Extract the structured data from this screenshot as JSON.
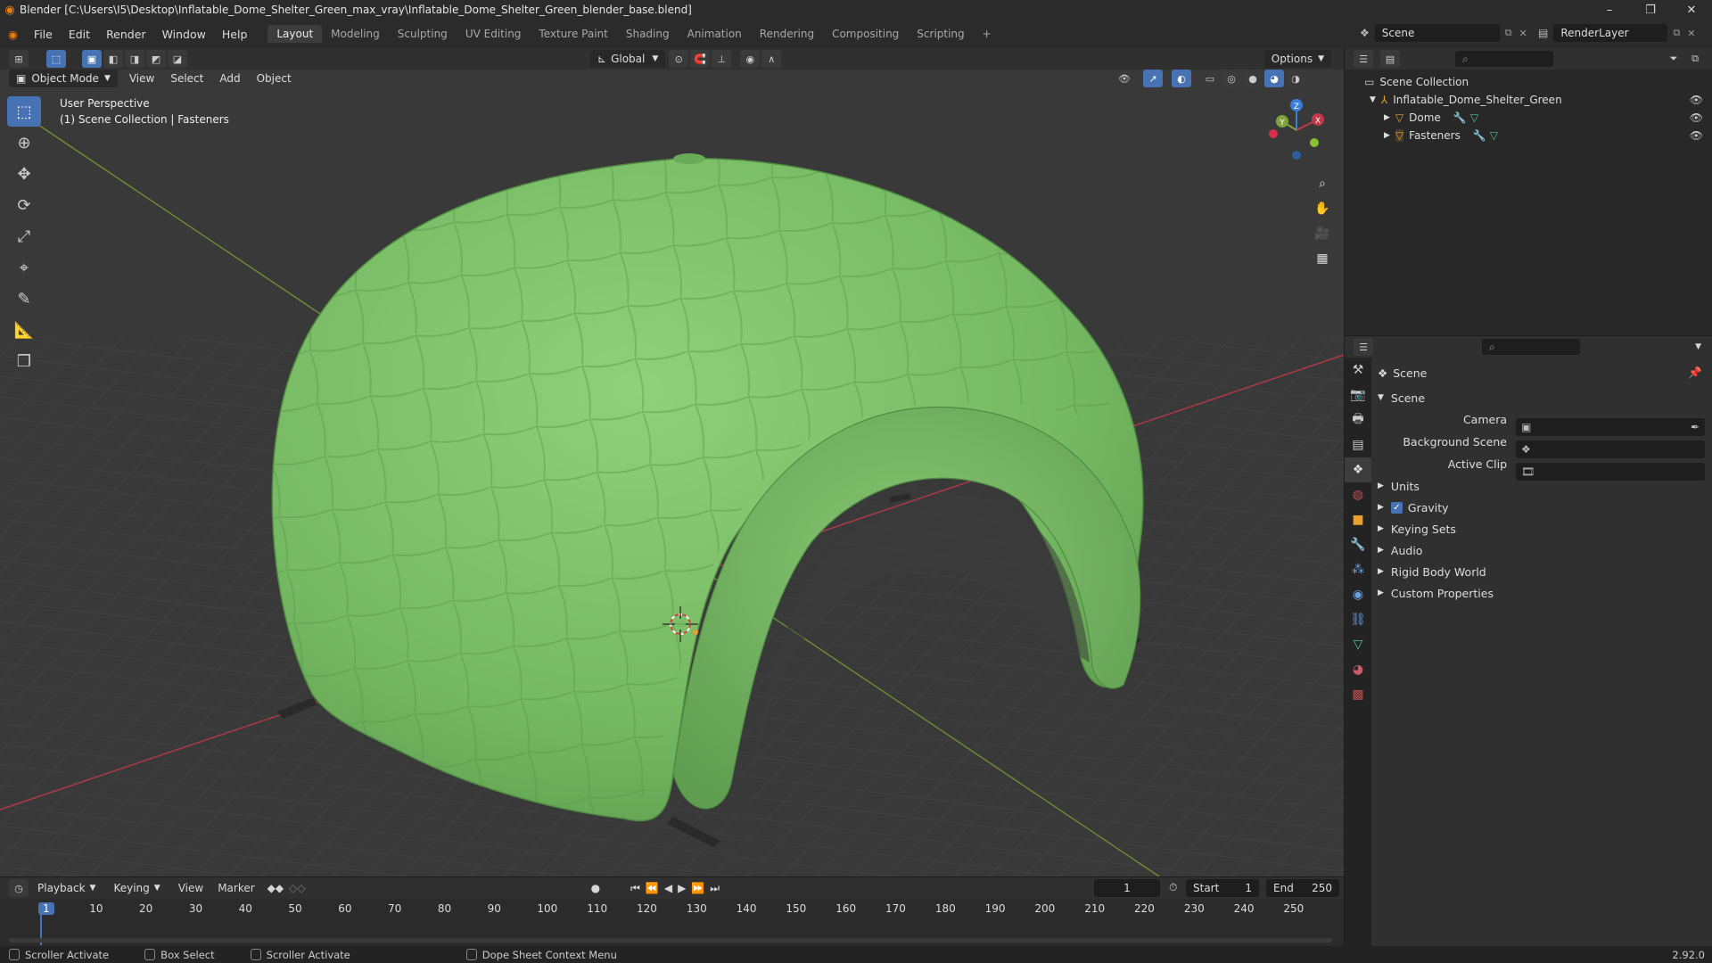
{
  "window": {
    "title": "Blender [C:\\Users\\I5\\Desktop\\Inflatable_Dome_Shelter_Green_max_vray\\Inflatable_Dome_Shelter_Green_blender_base.blend]",
    "controls": [
      "–",
      "❐",
      "✕"
    ]
  },
  "menu": [
    "File",
    "Edit",
    "Render",
    "Window",
    "Help"
  ],
  "workspaces": [
    "Layout",
    "Modeling",
    "Sculpting",
    "UV Editing",
    "Texture Paint",
    "Shading",
    "Animation",
    "Rendering",
    "Compositing",
    "Scripting",
    "+"
  ],
  "active_workspace": "Layout",
  "scene_selector": "Scene",
  "viewlayer_selector": "RenderLayer",
  "viewport_header": {
    "mode": "Object Mode",
    "menus": [
      "View",
      "Select",
      "Add",
      "Object"
    ],
    "transform_orientation": "Global",
    "options": "Options"
  },
  "viewport": {
    "perspective_label": "User Perspective",
    "collection_label": "(1) Scene Collection | Fasteners",
    "axis_labels": {
      "x": "X",
      "y": "Y",
      "z": "Z"
    }
  },
  "tools": [
    {
      "name": "select-box-tool",
      "glyph": "⬚"
    },
    {
      "name": "cursor-tool",
      "glyph": "⊕"
    },
    {
      "name": "move-tool",
      "glyph": "✥"
    },
    {
      "name": "rotate-tool",
      "glyph": "⟳"
    },
    {
      "name": "scale-tool",
      "glyph": "⤢"
    },
    {
      "name": "transform-tool",
      "glyph": "⌖"
    },
    {
      "name": "annotate-tool",
      "glyph": "✎"
    },
    {
      "name": "measure-tool",
      "glyph": "📐"
    },
    {
      "name": "add-cube-tool",
      "glyph": "❒"
    }
  ],
  "outliner": {
    "root": "Scene Collection",
    "items": [
      {
        "label": "Inflatable_Dome_Shelter_Green",
        "level": 1
      },
      {
        "label": "Dome",
        "level": 2
      },
      {
        "label": "Fasteners",
        "level": 2
      }
    ]
  },
  "properties": {
    "header": "Scene",
    "panel": "Scene",
    "fields": [
      {
        "label": "Camera",
        "value": ""
      },
      {
        "label": "Background Scene",
        "value": ""
      },
      {
        "label": "Active Clip",
        "value": ""
      }
    ],
    "subpanels": [
      "Units",
      "Gravity",
      "Keying Sets",
      "Audio",
      "Rigid Body World",
      "Custom Properties"
    ],
    "gravity_checked": true
  },
  "timeline": {
    "menus": [
      "Playback",
      "Keying",
      "View",
      "Marker"
    ],
    "current_frame": "1",
    "start_label": "Start",
    "start": "1",
    "end_label": "End",
    "end": "250",
    "ticks": [
      "1",
      "10",
      "20",
      "30",
      "40",
      "50",
      "60",
      "70",
      "80",
      "90",
      "100",
      "110",
      "120",
      "130",
      "140",
      "150",
      "160",
      "170",
      "180",
      "190",
      "200",
      "210",
      "220",
      "230",
      "240",
      "250"
    ]
  },
  "statusbar": {
    "items": [
      "Scroller Activate",
      "Box Select",
      "Scroller Activate",
      "Dope Sheet Context Menu"
    ],
    "version": "2.92.0"
  },
  "colors": {
    "accent": "#4772b3",
    "dome_green": "#7fc06a",
    "x_axis": "#c0394b",
    "y_axis": "#7ea33a",
    "z_axis": "#3a7ed8"
  }
}
